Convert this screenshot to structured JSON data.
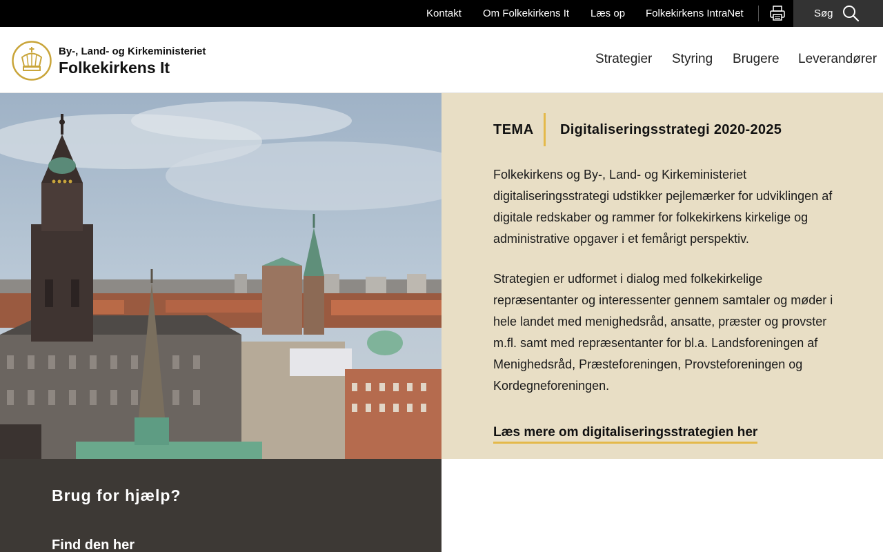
{
  "topbar": {
    "links": [
      "Kontakt",
      "Om Folkekirkens It",
      "Læs op",
      "Folkekirkens IntraNet"
    ],
    "print_icon": "printer-icon",
    "search_label": "Søg",
    "search_icon": "magnifier-icon"
  },
  "header": {
    "logo_icon": "crown-seal-icon",
    "logo_line1": "By-, Land- og Kirkeministeriet",
    "logo_line2": "Folkekirkens It",
    "nav": [
      "Strategier",
      "Styring",
      "Brugere",
      "Leverandører"
    ]
  },
  "hero": {
    "tema_label": "TEMA",
    "title": "Digitaliseringsstrategi 2020-2025",
    "paragraph1": "Folkekirkens og By-, Land- og Kirkeministeriet digitaliseringsstrategi udstikker pejlemærker for udviklingen af digitale redskaber og rammer for folkekirkens kirkelige og administrative opgaver i et femårigt perspektiv.",
    "paragraph2": "Strategien er udformet i dialog med folkekirkelige repræsentanter og interessenter gennem samtaler og møder i hele landet med menighedsråd, ansatte, præster og provster m.fl. samt med repræsentanter for bl.a. Landsforeningen af Menighedsråd, Præsteforeningen, Provsteforeningen og Kordegneforeningen.",
    "cta": "Læs mere om digitaliseringsstrategien her"
  },
  "help": {
    "title": "Brug for hjælp?",
    "link": "Find den her"
  },
  "colors": {
    "topbar_bg": "#000000",
    "accent_gold": "#e4b94a",
    "panel_beige": "#e8dec5",
    "help_bg": "#3d3935"
  }
}
